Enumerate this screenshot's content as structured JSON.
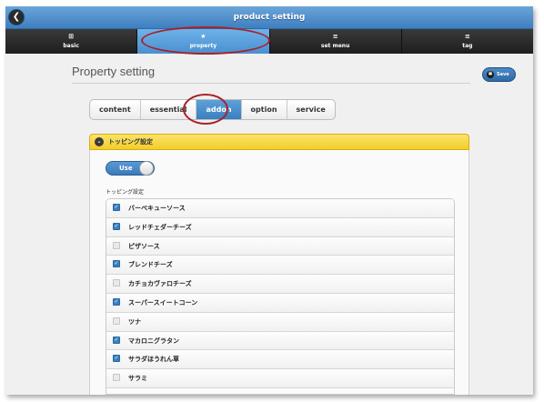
{
  "header": {
    "title": "product setting",
    "back_icon": "chevron-left-icon"
  },
  "nav": {
    "tabs": [
      {
        "label": "basic",
        "icon": "grid-icon",
        "glyph": "⊞",
        "active": false
      },
      {
        "label": "property",
        "icon": "star-icon",
        "glyph": "★",
        "active": true
      },
      {
        "label": "set menu",
        "icon": "list-icon",
        "glyph": "≡",
        "active": false
      },
      {
        "label": "tag",
        "icon": "list-icon",
        "glyph": "≡",
        "active": false
      }
    ]
  },
  "page": {
    "title": "Property setting",
    "save_label": "Save"
  },
  "segments": [
    {
      "label": "content",
      "active": false
    },
    {
      "label": "essential",
      "active": false
    },
    {
      "label": "addon",
      "active": true
    },
    {
      "label": "option",
      "active": false
    },
    {
      "label": "service",
      "active": false
    }
  ],
  "panel": {
    "title": "トッピング設定"
  },
  "toggle": {
    "label": "Use",
    "on": true
  },
  "list": {
    "label": "トッピング設定",
    "items": [
      {
        "label": "バーベキューソース",
        "checked": true
      },
      {
        "label": "レッドチェダーチーズ",
        "checked": true
      },
      {
        "label": "ピザソース",
        "checked": false
      },
      {
        "label": "ブレンドチーズ",
        "checked": true
      },
      {
        "label": "カチョカヴァロチーズ",
        "checked": false
      },
      {
        "label": "スーパースイートコーン",
        "checked": true
      },
      {
        "label": "ツナ",
        "checked": false
      },
      {
        "label": "マカロニグラタン",
        "checked": true
      },
      {
        "label": "サラダほうれん草",
        "checked": true
      },
      {
        "label": "サラミ",
        "checked": false
      },
      {
        "label": "",
        "checked": false
      }
    ]
  },
  "colors": {
    "header_blue": "#3f7fc0",
    "active_tab_blue": "#4a90d0",
    "panel_yellow": "#f3cd2a",
    "annotation_red": "#a7222c"
  }
}
